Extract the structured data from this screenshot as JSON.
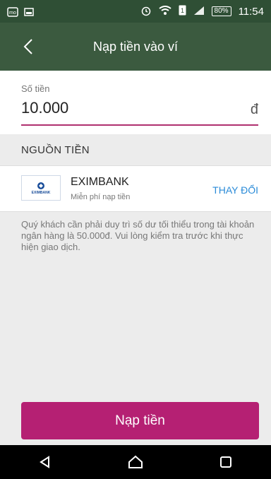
{
  "status_bar": {
    "battery": "80%",
    "time": "11:54"
  },
  "app_bar": {
    "title": "Nạp tiền vào ví"
  },
  "amount": {
    "label": "Số tiền",
    "value": "10.000",
    "currency": "đ"
  },
  "source": {
    "header": "NGUỒN TIỀN",
    "bank_name": "EXIMBANK",
    "bank_subtitle": "Miễn phí nạp tiền",
    "logo_text": "EXIMBANK",
    "change_label": "THAY ĐỔI"
  },
  "note": "Quý khách cần phải duy trì số dư tối thiểu trong tài khoản ngân hàng là 50.000đ. Vui lòng kiểm tra trước khi thực hiện giao dịch.",
  "primary_button": {
    "label": "Nạp tiền"
  },
  "colors": {
    "appbar": "#3b5a3f",
    "accent": "#b52073",
    "link": "#2a8bd8"
  }
}
